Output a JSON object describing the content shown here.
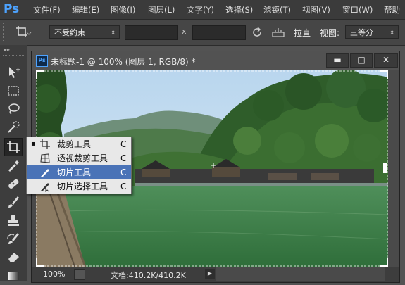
{
  "app": {
    "logo": "Ps"
  },
  "menu": [
    "文件(F)",
    "编辑(E)",
    "图像(I)",
    "图层(L)",
    "文字(Y)",
    "选择(S)",
    "滤镜(T)",
    "视图(V)",
    "窗口(W)",
    "帮助"
  ],
  "options": {
    "ratio_combo": "不受约束",
    "separator": "x",
    "straighten_label": "拉直",
    "view_label": "视图:",
    "view_combo": "三等分"
  },
  "document": {
    "title": "未标题-1 @ 100% (图层 1, RGB/8) *",
    "zoom": "100%",
    "doc_info": "文档:410.2K/410.2K"
  },
  "flyout": {
    "items": [
      {
        "label": "裁剪工具",
        "shortcut": "C",
        "icon": "crop-icon",
        "active": true
      },
      {
        "label": "透视裁剪工具",
        "shortcut": "C",
        "icon": "perspective-crop-icon",
        "active": false
      },
      {
        "label": "切片工具",
        "shortcut": "C",
        "icon": "slice-icon",
        "active": false
      },
      {
        "label": "切片选择工具",
        "shortcut": "C",
        "icon": "slice-select-icon",
        "active": false
      }
    ],
    "highlighted_index": 2
  },
  "colors": {
    "accent": "#4a73b7",
    "ps_blue": "#4da3ff",
    "chrome": "#3b3b3b"
  }
}
